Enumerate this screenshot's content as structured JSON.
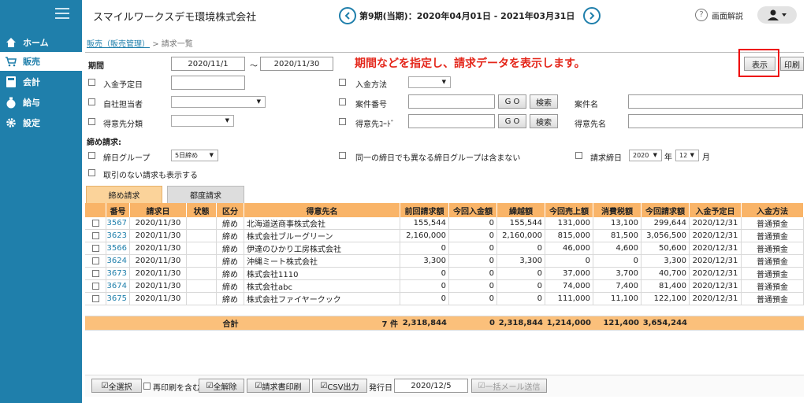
{
  "company_name": "スマイルワークスデモ環境株式会社",
  "period_title": "第9期(当期)：2020年04月01日 - 2021年03月31日",
  "help_label": "画面解説",
  "nav": [
    {
      "label": "ホーム",
      "icon": "home-icon"
    },
    {
      "label": "販売",
      "icon": "cart-icon"
    },
    {
      "label": "会計",
      "icon": "calculator-icon"
    },
    {
      "label": "給与",
      "icon": "money-bag-icon"
    },
    {
      "label": "設定",
      "icon": "gear-icon"
    }
  ],
  "breadcrumb": {
    "parent": "販売（販売管理）",
    "sep": ">",
    "current": "請求一覧"
  },
  "filters": {
    "period_label": "期間",
    "period_from": "2020/11/1",
    "tilde": "～",
    "period_to": "2020/11/30",
    "due_date_label": "入金予定日",
    "staff_label": "自社担当者",
    "client_cat_label": "得意先分類",
    "pay_method_label": "入金方法",
    "case_no_label": "案件番号",
    "client_code_label": "得意先ｺｰﾄﾞ",
    "case_name_label": "案件名",
    "client_name_label": "得意先名",
    "go": "G O",
    "search": "検索"
  },
  "instruction": "期間などを指定し、請求データを表示します。",
  "buttons": {
    "show": "表示",
    "print": "印刷"
  },
  "closing": {
    "section_label": "締め請求:",
    "group_label": "締日グループ",
    "group_value": "5日締め",
    "exclude_label": "同一の締日でも異なる締日グループは含まない",
    "bill_date_label": "請求締日",
    "year_value": "2020",
    "year_unit": "年",
    "month_value": "12",
    "month_unit": "月",
    "include_none_label": "取引のない請求も表示する"
  },
  "tabs": [
    "締め請求",
    "都度請求"
  ],
  "table": {
    "headers": [
      "番号",
      "請求日",
      "状態",
      "区分",
      "得意先名",
      "前回請求額",
      "今回入金額",
      "繰越額",
      "今回売上額",
      "消費税額",
      "今回請求額",
      "入金予定日",
      "入金方法"
    ],
    "rows": [
      [
        "3567",
        "2020/11/30",
        "",
        "締め",
        "北海道送商事株式会社",
        "155,544",
        "0",
        "155,544",
        "131,000",
        "13,100",
        "299,644",
        "2020/12/31",
        "普通預金"
      ],
      [
        "3623",
        "2020/11/30",
        "",
        "締め",
        "株式会社ブルーグリーン",
        "2,160,000",
        "0",
        "2,160,000",
        "815,000",
        "81,500",
        "3,056,500",
        "2020/12/31",
        "普通預金"
      ],
      [
        "3566",
        "2020/11/30",
        "",
        "締め",
        "伊達のひかり工房株式会社",
        "0",
        "0",
        "0",
        "46,000",
        "4,600",
        "50,600",
        "2020/12/31",
        "普通預金"
      ],
      [
        "3624",
        "2020/11/30",
        "",
        "締め",
        "沖縄ミート株式会社",
        "3,300",
        "0",
        "3,300",
        "0",
        "0",
        "3,300",
        "2020/12/31",
        "普通預金"
      ],
      [
        "3673",
        "2020/11/30",
        "",
        "締め",
        "株式会社1110",
        "0",
        "0",
        "0",
        "37,000",
        "3,700",
        "40,700",
        "2020/12/31",
        "普通預金"
      ],
      [
        "3674",
        "2020/11/30",
        "",
        "締め",
        "株式会社abc",
        "0",
        "0",
        "0",
        "74,000",
        "7,400",
        "81,400",
        "2020/12/31",
        "普通預金"
      ],
      [
        "3675",
        "2020/11/30",
        "",
        "締め",
        "株式会社ファイヤークック",
        "0",
        "0",
        "0",
        "111,000",
        "11,100",
        "122,100",
        "2020/12/31",
        "普通預金"
      ]
    ],
    "total": {
      "label": "合計",
      "count": "7 件",
      "prev": "2,318,844",
      "paid": "0",
      "carry": "2,318,844",
      "sales": "1,214,000",
      "tax": "121,400",
      "billed": "3,654,244"
    }
  },
  "bottom": {
    "select_all": "全選択",
    "reprint": "再印刷を含む",
    "deselect_all": "全解除",
    "print_invoice": "請求書印刷",
    "csv": "CSV出力",
    "issue_label": "発行日",
    "issue_date": "2020/12/5",
    "bulk_mail": "一括メール送信"
  }
}
